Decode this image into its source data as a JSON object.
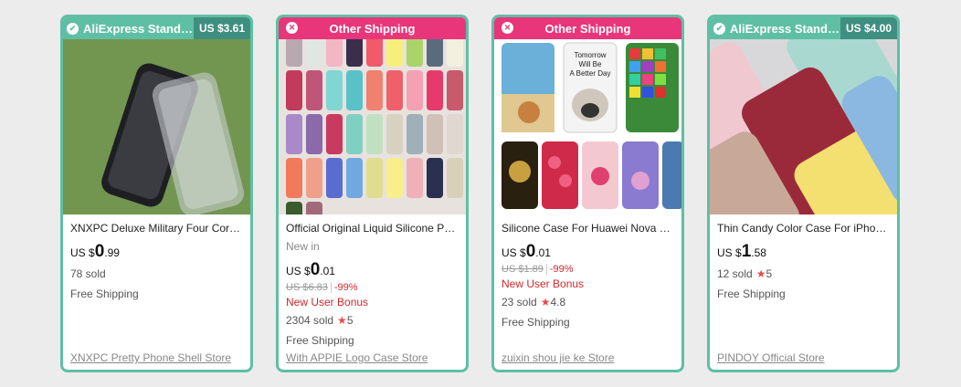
{
  "cards": [
    {
      "banner_type": "standard",
      "banner_icon": "check-icon",
      "banner_label": "AliExpress Standard...",
      "banner_price": "US $3.61",
      "title": "XNXPC Deluxe Military Four Corn...",
      "subtitle": "",
      "currency": "US $",
      "price_int": "0",
      "price_dec": ".99",
      "orig_price": "",
      "discount": "",
      "bonus": "",
      "sold": "78 sold",
      "rating": "",
      "shipping": "Free Shipping",
      "store": "XNXPC Pretty Phone Shell Store"
    },
    {
      "banner_type": "other",
      "banner_icon": "x-icon",
      "banner_label": "Other Shipping",
      "banner_price": "",
      "title": "Official Original Liquid Silicone Ph...",
      "subtitle": "New in",
      "currency": "US $",
      "price_int": "0",
      "price_dec": ".01",
      "orig_price": "US $6.83",
      "discount": "-99%",
      "bonus": "New User Bonus",
      "sold": "2304 sold",
      "rating": "5",
      "shipping": "Free Shipping",
      "store": "With APPIE Logo Case Store"
    },
    {
      "banner_type": "other",
      "banner_icon": "x-icon",
      "banner_label": "Other Shipping",
      "banner_price": "",
      "title": "Silicone Case For Huawei Nova 3 ...",
      "subtitle": "",
      "currency": "US $",
      "price_int": "0",
      "price_dec": ".01",
      "orig_price": "US $1.89",
      "discount": "-99%",
      "bonus": "New User Bonus",
      "sold": "23 sold",
      "rating": "4.8",
      "shipping": "Free Shipping",
      "store": "zuixin shou jie ke Store",
      "image_text": [
        "Tomorrow",
        "Will Be",
        "A Better Day"
      ]
    },
    {
      "banner_type": "standard",
      "banner_icon": "check-icon",
      "banner_label": "AliExpress Standard...",
      "banner_price": "US $4.00",
      "title": "Thin Candy Color Case For iPhon...",
      "subtitle": "",
      "currency": "US $",
      "price_int": "1",
      "price_dec": ".58",
      "orig_price": "",
      "discount": "",
      "bonus": "",
      "sold": "12 sold",
      "rating": "5",
      "shipping": "Free Shipping",
      "store": "PINDOY Official Store"
    }
  ],
  "colors": {
    "card_border": "#5fbfa4",
    "standard_banner": "#5fbfa4",
    "other_banner": "#e9357a",
    "discount_red": "#d12a2a",
    "star": "#e84a4a"
  }
}
